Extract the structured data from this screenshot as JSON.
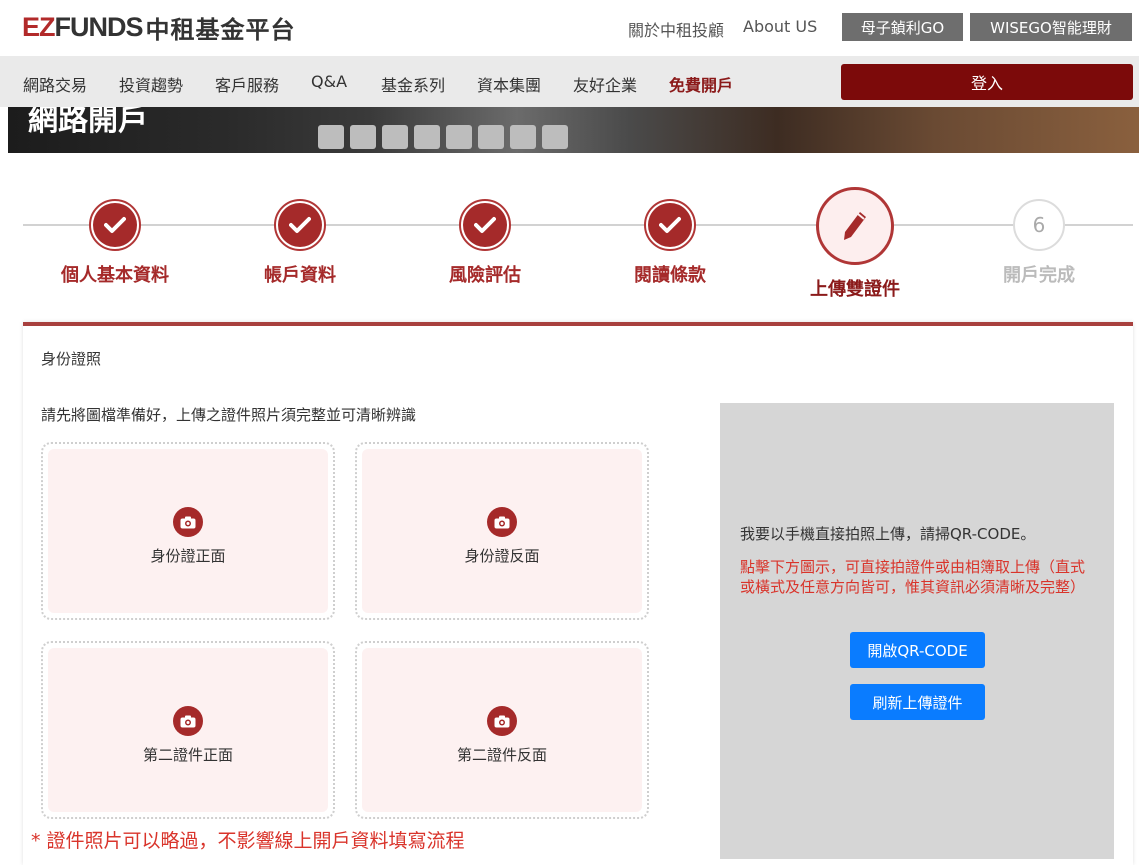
{
  "header": {
    "logo_ez": "EZ",
    "logo_funds": "FUNDS",
    "logo_cn": "中租基金平台",
    "links": [
      "關於中租投顧",
      "About US"
    ],
    "buttons": [
      "母子鍞利GO",
      "WISEGO智能理財"
    ]
  },
  "nav": {
    "items": [
      "網路交易",
      "投資趨勢",
      "客戶服務",
      "Q&A",
      "基金系列",
      "資本集團",
      "友好企業",
      "免費開戶"
    ],
    "login_label": "登入"
  },
  "banner": {
    "title": "網路開戶"
  },
  "steps": [
    {
      "label": "個人基本資料",
      "state": "done"
    },
    {
      "label": "帳戶資料",
      "state": "done"
    },
    {
      "label": "風險評估",
      "state": "done"
    },
    {
      "label": "閱讀條款",
      "state": "done"
    },
    {
      "label": "上傳雙證件",
      "state": "current"
    },
    {
      "label": "開戶完成",
      "state": "todo",
      "number": "6"
    }
  ],
  "card": {
    "title": "身份證照",
    "instruction": "請先將圖檔準備好，上傳之證件照片須完整並可清晰辨識",
    "uploads": [
      "身份證正面",
      "身份證反面",
      "第二證件正面",
      "第二證件反面"
    ],
    "note": "* 證件照片可以略過，不影響線上開戶資料填寫流程"
  },
  "qr": {
    "text1": "我要以手機直接拍照上傳，請掃QR-CODE。",
    "text2": "點擊下方圖示，可直接拍證件或由相簿取上傳（直式或橫式及任意方向皆可，惟其資訊必須清晰及完整）",
    "open_label": "開啟QR-CODE",
    "refresh_label": "刷新上傳證件"
  },
  "colors": {
    "brand_red": "#a52a2a",
    "login_red": "#7c0a0a",
    "alert_red": "#d9342b",
    "blue": "#0a7cff",
    "panel_gray": "#d6d6d6"
  },
  "icons": [
    "check-icon",
    "pencil-icon",
    "camera-icon"
  ]
}
